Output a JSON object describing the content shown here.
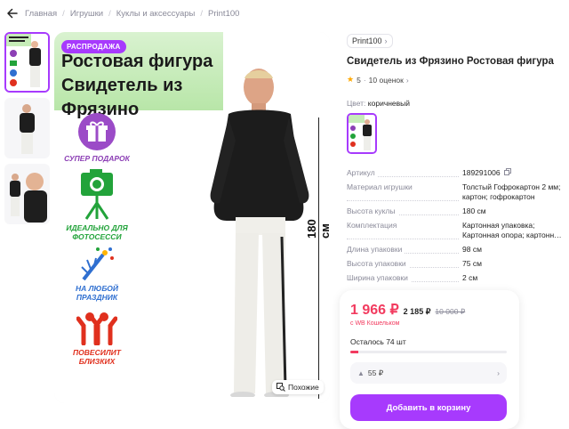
{
  "breadcrumb": {
    "back_icon": "arrow-left-icon",
    "items": [
      "Главная",
      "Игрушки",
      "Куклы и аксессуары",
      "Print100"
    ]
  },
  "gallery": {
    "sale_badge": "РАСПРОДАЖА",
    "promo_title": [
      "Ростовая фигура",
      "Свидетель из",
      "Фрязино"
    ],
    "features": [
      {
        "icon": "gift-icon",
        "label": "СУПЕР ПОДАРОК"
      },
      {
        "icon": "camera-icon",
        "label": "ИДЕАЛЬНО ДЛЯ ФОТОСЕССИ"
      },
      {
        "icon": "fireworks-icon",
        "label": "НА ЛЮБОЙ ПРАЗДНИК"
      },
      {
        "icon": "people-icon",
        "label": "ПОВЕСИЛИТ БЛИЗКИХ"
      }
    ],
    "height_label": "180 см",
    "similar_label": "Похожие"
  },
  "product": {
    "brand": "Print100",
    "title": "Свидетель из Фрязино Ростовая фигура",
    "rating": "5",
    "reviews": "10 оценок",
    "color_label": "Цвет:",
    "color_value": "коричневый",
    "specs": [
      {
        "name": "Артикул",
        "value": "189291006"
      },
      {
        "name": "Материал игрушки",
        "value": "Толстый Гофрокартон 2 мм; картон; гофрокартон"
      },
      {
        "name": "Высота куклы",
        "value": "180 см"
      },
      {
        "name": "Комплектация",
        "value": "Картонная упаковка; Картонная опора; картонн…"
      },
      {
        "name": "Длина упаковки",
        "value": "98 см"
      },
      {
        "name": "Высота упаковки",
        "value": "75 см"
      },
      {
        "name": "Ширина упаковки",
        "value": "2 см"
      }
    ]
  },
  "price": {
    "main": "1 966 ₽",
    "regular": "2 185 ₽",
    "old": "10 000 ₽",
    "wallet": "с WB Кошельком",
    "stock": "Осталось 74 шт",
    "stock_level": 0.05,
    "installment": "55 ₽",
    "cart_button": "Добавить в корзину"
  },
  "colors": {
    "accent": "#a73afd",
    "price": "#f23b5f"
  }
}
